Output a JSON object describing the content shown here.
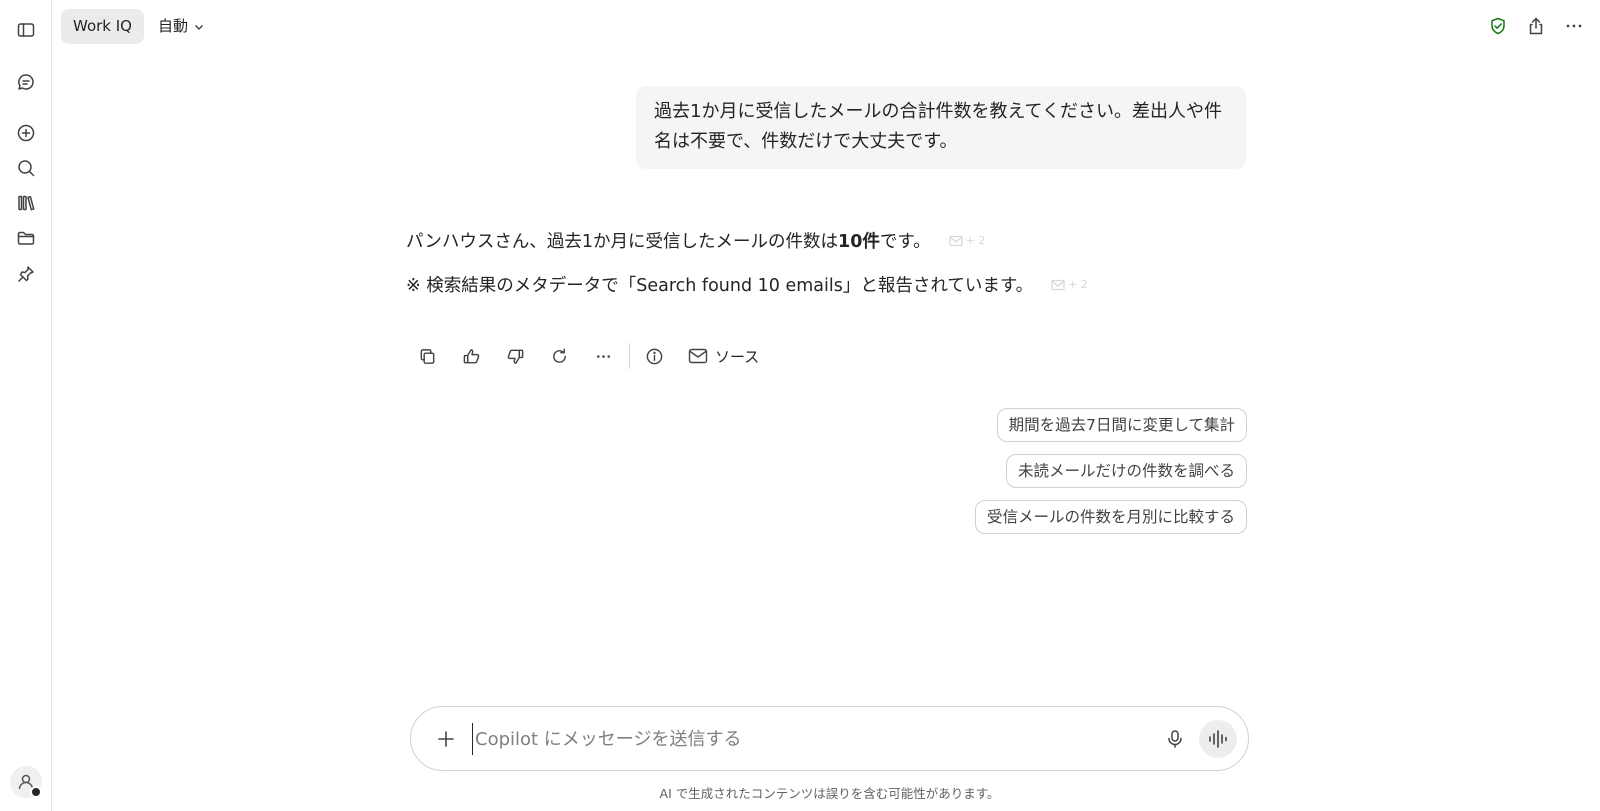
{
  "header": {
    "agent_label": "Work IQ",
    "mode_label": "自動"
  },
  "sidebar": {
    "items": [
      {
        "icon": "sidebar-toggle-icon"
      },
      {
        "icon": "chat-icon"
      },
      {
        "icon": "new-chat-icon"
      },
      {
        "icon": "search-icon"
      },
      {
        "icon": "library-icon"
      },
      {
        "icon": "folder-icon"
      },
      {
        "icon": "pin-icon"
      }
    ],
    "avatar_icon": "user-icon"
  },
  "conversation": {
    "user_message": "過去1か月に受信したメールの合計件数を教えてください。差出人や件名は不要で、件数だけで大丈夫です。",
    "response": {
      "line1_prefix": "パンハウスさん、過去1か月に受信したメールの件数は ",
      "line1_bold": "10件",
      "line1_suffix": " です。",
      "line1_citation": "+ 2",
      "line2_text": "※ 検索結果のメタデータで「Search found 10 emails」と報告されています。",
      "line2_citation": "+ 2"
    },
    "sources_label": "ソース"
  },
  "suggestions": [
    "期間を過去7日間に変更して集計",
    "未読メールだけの件数を調べる",
    "受信メールの件数を月別に比較する"
  ],
  "composer": {
    "placeholder": "Copilot にメッセージを送信する",
    "value": ""
  },
  "footer": {
    "disclaimer": "AI で生成されたコンテンツは誤りを含む可能性があります。"
  },
  "colors": {
    "shield": "#107c10",
    "bubble": "#f5f5f5",
    "pill": "#ebebeb"
  }
}
